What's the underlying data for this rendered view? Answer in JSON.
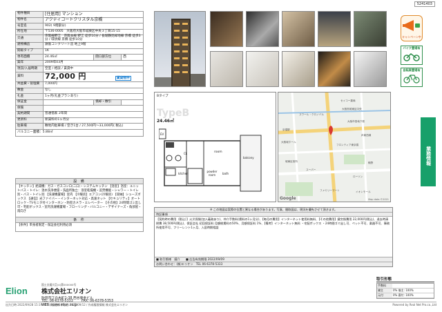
{
  "doc_id": "5241403",
  "info": {
    "rows": [
      {
        "k": "物件種目",
        "v": "[住居用] マンション",
        "big": true
      },
      {
        "k": "物件名",
        "v": "アクティコートクリスタル京橋",
        "big": true
      },
      {
        "k": "号室名",
        "v": "902( 9階部分)"
      },
      {
        "k": "所在地",
        "v": "〒536-0005　大阪府大阪市城東区中央３丁目15-15"
      },
      {
        "k": "交通",
        "v": "京阪線野江　京阪本線 野江 徒歩10分 / 長堀鶴見緑地線 京橋 徒歩3分 / 環状線 京橋 徒歩10分"
      },
      {
        "k": "建物構造",
        "v": "鉄筋コンクリート造 地上9階"
      },
      {
        "k": "間取タイプ",
        "v": "1K"
      },
      {
        "k": "専有面積",
        "v": "24.46㎡",
        "k2": "開口部方位",
        "v2": "西"
      },
      {
        "k": "築年",
        "v": "2009年03月"
      },
      {
        "k": "現況/入居時期",
        "v": "空室 / 相談 / 賃貸中"
      }
    ],
    "price_label": "賃料",
    "price": "72,000 円",
    "badge": "賃貸物件",
    "rows2": [
      {
        "k": "共益費・管理費",
        "v": "7,000円"
      },
      {
        "k": "敷金",
        "v": "なし"
      },
      {
        "k": "礼金",
        "v": "1ヶ月(礼金プランあり)"
      },
      {
        "k": "保証金",
        "v": "",
        "k2": "償却・敷引",
        "v2": ""
      },
      {
        "k": "保険",
        "v": ""
      },
      {
        "k": "契約期間",
        "v": "普通借家 2年間"
      },
      {
        "k": "更新料",
        "v": "新賃料の1ヶ月分"
      },
      {
        "k": "駐車場",
        "v": "敷地内駐車場 / 空き1台 / 27,500円〜33,000円( 税込)"
      }
    ],
    "balcony": "バルコニー面積：5.88㎡"
  },
  "equipment": {
    "title": "設 備",
    "text": "【キッチン】給湯機：ガス・ガスコンロ(二口)・システムキッチン 【浴室】浴室：ユニットバス・トイレ：温水洗浄便座・洗面所独立：浴室乾燥機・追焚機能・シャワー・トイレ別・バス・トイレ別 【洗濯機置場】室内 【冷暖房】エアコン(冷暖房) 【収納】シューズボックス 【通信】光ファイバー・インターネット対応・高速ネット 【セキュリティ】オートロック・TVモニタ付インターホン・防犯カメラ・エレベーター 【その他】24時間ゴミ出し可・宅配ボックス・室内洗濯機置場・フローリング・バルコニー・デザイナーズ・角部屋・南向き"
  },
  "conditions": {
    "title": "条 件",
    "text": "【条件】単身者限定・保証会社利用必須"
  },
  "side": {
    "campaign": "キャンペーン中",
    "bike": "バイク置場有",
    "bicycle": "自転車置場有",
    "label": "業務情報"
  },
  "floor": {
    "title": "Bタイプ",
    "type_tag": "TypeB",
    "area": "24.46㎡",
    "rooms": {
      "balcony": "balcony",
      "room": "room",
      "kitchen": "kitchen",
      "powder": "powder room",
      "bath": "bath",
      "entrance": "EV",
      "cl": "CL"
    }
  },
  "map": {
    "labels": [
      "スワール・クロノバル",
      "大阪府城東区中央",
      "大阪市営地下鉄",
      "セイコー薬局",
      "京橋駅",
      "JR東西線",
      "城東区役所",
      "フロンティア東京橋",
      "鴨野",
      "スーパー",
      "ローソン",
      "ファミリーマート",
      "イオンモール",
      "大阪城ホール"
    ],
    "footer": "Map data ©2021",
    "logo": "Google"
  },
  "remarks": {
    "note": "※ この地図は実際の位置と異なる場合があります。写真、間取図は、現況を優先させて頂きます。",
    "header": "特記事項",
    "text": "【契約時の費用（税込）】火災保険(加入義務あり)、仲介手数料(賃料の1ヶ月分)、【毎月の費用】インターネット使用料無料、【その他費用】鍵交換費用 22,000円(税込)、退去時清掃費 38,500円(税込)、保証会社 初回保証料 月額総賃料の50%、月額保証料 1%、【備考】インターネット無料 ・宅配ボックス ・24時間ゴミ出し可、ペット不可、楽器不可、事務所使用不可、フリーレント1ヶ月、入居時期相談",
    "footer": "■ 取引態様　媒介　　■ 広告有効期限 2022/09/09",
    "contact": "お問い合わせ：(株)エリオン　TEL 06-6378-5333"
  },
  "company": {
    "logo": "Elion",
    "license": "国土交通大臣(4)第000000号",
    "name": "株式会社エリオン",
    "address": "吹田市江の木町1-38 西谷東金ビル",
    "tel": "TEL: 06-6378-5333",
    "fax": "FAX: 06-6378-5353",
    "web": "WEB: kanri.elion.co.jp"
  },
  "fees": {
    "title": "取引形態",
    "rows": [
      {
        "k": "手数料",
        "v": ""
      },
      {
        "k": "貸主",
        "v": "0% 借主: 100%"
      },
      {
        "k": "元付",
        "v": "0% 客付: 100%"
      }
    ]
  },
  "footer": {
    "left": "出力日時 2022/09/28 15:19:04 / 次回更新予定日 2022/09/12 / 作成権限情報 株式会社エリオン",
    "right": "Powered by Real Net Pro.co.,Ltd"
  }
}
